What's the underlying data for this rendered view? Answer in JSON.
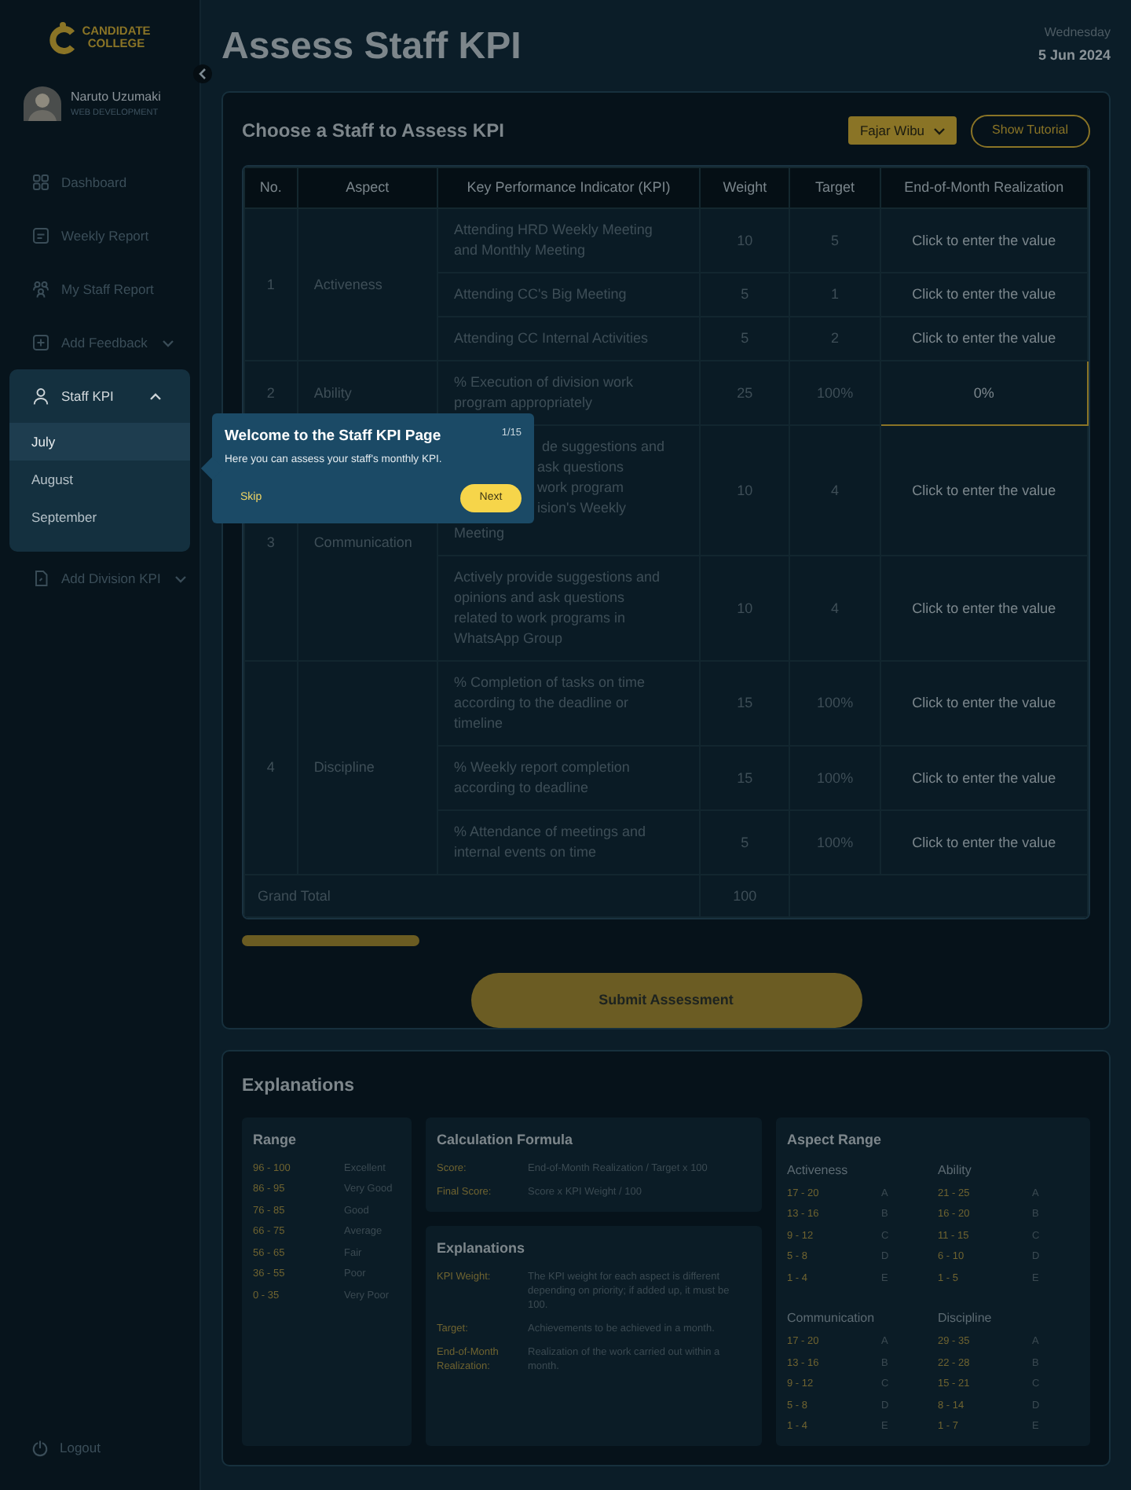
{
  "logo": {
    "lines": [
      "CANDIDATE",
      "COLLEGE"
    ]
  },
  "profile": {
    "name": "Naruto Uzumaki",
    "role": "WEB DEVELOPMENT"
  },
  "sidebar": {
    "items": [
      {
        "label": "Dashboard"
      },
      {
        "label": "Weekly Report"
      },
      {
        "label": "My Staff Report"
      },
      {
        "label": "Add Feedback",
        "expanded": false
      },
      {
        "label": "Staff KPI",
        "expanded": true,
        "children": [
          {
            "label": "July",
            "selected": true
          },
          {
            "label": "August",
            "selected": false
          },
          {
            "label": "September",
            "selected": false
          }
        ]
      },
      {
        "label": "Add Division KPI",
        "expanded": false
      }
    ],
    "logout": "Logout"
  },
  "header": {
    "title": "Assess Staff KPI",
    "day": "Wednesday",
    "date": "5 Jun 2024"
  },
  "assessment": {
    "title": "Choose a  Staff to Assess KPI",
    "staff_dropdown": "Fajar Wibu",
    "tutorial_button": "Show Tutorial",
    "table": {
      "columns": [
        "No.",
        "Aspect",
        "Key Performance Indicator (KPI)",
        "Weight",
        "Target",
        "End-of-Month Realization"
      ],
      "groups": [
        {
          "no": "1",
          "aspect": "Activeness",
          "kpis": [
            {
              "kind": "text",
              "text": "Attending HRD Weekly Meeting and Monthly Meeting",
              "weight": "10",
              "target": "5",
              "realization": "Click to enter the value",
              "selected": false
            },
            {
              "kind": "text",
              "text": "Attending CC's Big Meeting",
              "weight": "5",
              "target": "1",
              "realization": "Click to enter the value",
              "selected": false
            },
            {
              "kind": "text",
              "text": "Attending CC Internal Activities",
              "weight": "5",
              "target": "2",
              "realization": "Click to enter the value",
              "selected": false
            }
          ]
        },
        {
          "no": "2",
          "aspect": "Ability",
          "kpis": [
            {
              "kind": "text",
              "text": "% Execution of division work program appropriately",
              "weight": "25",
              "target": "100%",
              "realization": "0%",
              "selected": true
            }
          ]
        },
        {
          "no": "3",
          "aspect": "Communication",
          "kpis": [
            {
              "kind": "partial",
              "lines": [
                "de suggestions and",
                "ask questions",
                "work program",
                "ision's Weekly",
                "Meeting"
              ],
              "weight": "10",
              "target": "4",
              "realization": "Click to enter the value",
              "selected": false
            },
            {
              "kind": "text",
              "text": "Actively provide suggestions and opinions and ask questions related to work programs in WhatsApp Group",
              "weight": "10",
              "target": "4",
              "realization": "Click to enter the value",
              "selected": false
            }
          ]
        },
        {
          "no": "4",
          "aspect": "Discipline",
          "kpis": [
            {
              "kind": "text",
              "text": "% Completion of tasks on time according to the deadline or timeline",
              "weight": "15",
              "target": "100%",
              "realization": "Click to enter the value",
              "selected": false
            },
            {
              "kind": "text",
              "text": "% Weekly report completion according to deadline",
              "weight": "15",
              "target": "100%",
              "realization": "Click to enter the value",
              "selected": false
            },
            {
              "kind": "text",
              "text": "% Attendance of meetings and internal events on time",
              "weight": "5",
              "target": "100%",
              "realization": "Click to enter the value",
              "selected": false
            }
          ]
        }
      ],
      "total": {
        "label": "Grand Total",
        "weight": "100"
      }
    },
    "submit_button": "Submit Assessment"
  },
  "tour": {
    "title": "Welcome to the Staff  KPI Page",
    "step": "1/15",
    "body": "Here you can assess your staff's monthly KPI.",
    "skip": "Skip",
    "next": "Next"
  },
  "explanations": {
    "title": "Explanations",
    "range": {
      "title": "Range",
      "rows": [
        {
          "range": "96 - 100",
          "label": "Excellent"
        },
        {
          "range": "86 - 95",
          "label": "Very Good"
        },
        {
          "range": "76 - 85",
          "label": "Good"
        },
        {
          "range": "66 - 75",
          "label": "Average"
        },
        {
          "range": "56 - 65",
          "label": "Fair"
        },
        {
          "range": "36 - 55",
          "label": "Poor"
        },
        {
          "range": "0 - 35",
          "label": "Very Poor"
        }
      ]
    },
    "formula": {
      "title": "Calculation Formula",
      "rows": [
        {
          "term": "Score:",
          "text": "End-of-Month Realization / Target x 100"
        },
        {
          "term": "Final Score:",
          "text": "Score x KPI Weight / 100"
        }
      ]
    },
    "notes": {
      "title": "Explanations",
      "rows": [
        {
          "term": "KPI Weight:",
          "text": "The KPI weight for each aspect is different depending on priority; if added up, it must be 100."
        },
        {
          "term": "Target:",
          "text": "Achievements to be achieved in a month."
        },
        {
          "term": "End-of-Month Realization:",
          "text": "Realization of the work carried out within a month."
        }
      ]
    },
    "aspect_range": {
      "title": "Aspect Range",
      "groups": [
        {
          "name": "Activeness",
          "rows": [
            {
              "range": "17 - 20",
              "grade": "A"
            },
            {
              "range": "13 - 16",
              "grade": "B"
            },
            {
              "range": "9 - 12",
              "grade": "C"
            },
            {
              "range": "5 - 8",
              "grade": "D"
            },
            {
              "range": "1 - 4",
              "grade": "E"
            }
          ]
        },
        {
          "name": "Ability",
          "rows": [
            {
              "range": "21 - 25",
              "grade": "A"
            },
            {
              "range": "16 - 20",
              "grade": "B"
            },
            {
              "range": "11 - 15",
              "grade": "C"
            },
            {
              "range": "6 - 10",
              "grade": "D"
            },
            {
              "range": "1 - 5",
              "grade": "E"
            }
          ]
        },
        {
          "name": "Communication",
          "rows": [
            {
              "range": "17 - 20",
              "grade": "A"
            },
            {
              "range": "13 - 16",
              "grade": "B"
            },
            {
              "range": "9 - 12",
              "grade": "C"
            },
            {
              "range": "5 - 8",
              "grade": "D"
            },
            {
              "range": "1 - 4",
              "grade": "E"
            }
          ]
        },
        {
          "name": "Discipline",
          "rows": [
            {
              "range": "29 - 35",
              "grade": "A"
            },
            {
              "range": "22 - 28",
              "grade": "B"
            },
            {
              "range": "15 - 21",
              "grade": "C"
            },
            {
              "range": "8 - 14",
              "grade": "D"
            },
            {
              "range": "1 - 7",
              "grade": "E"
            }
          ]
        }
      ]
    }
  }
}
